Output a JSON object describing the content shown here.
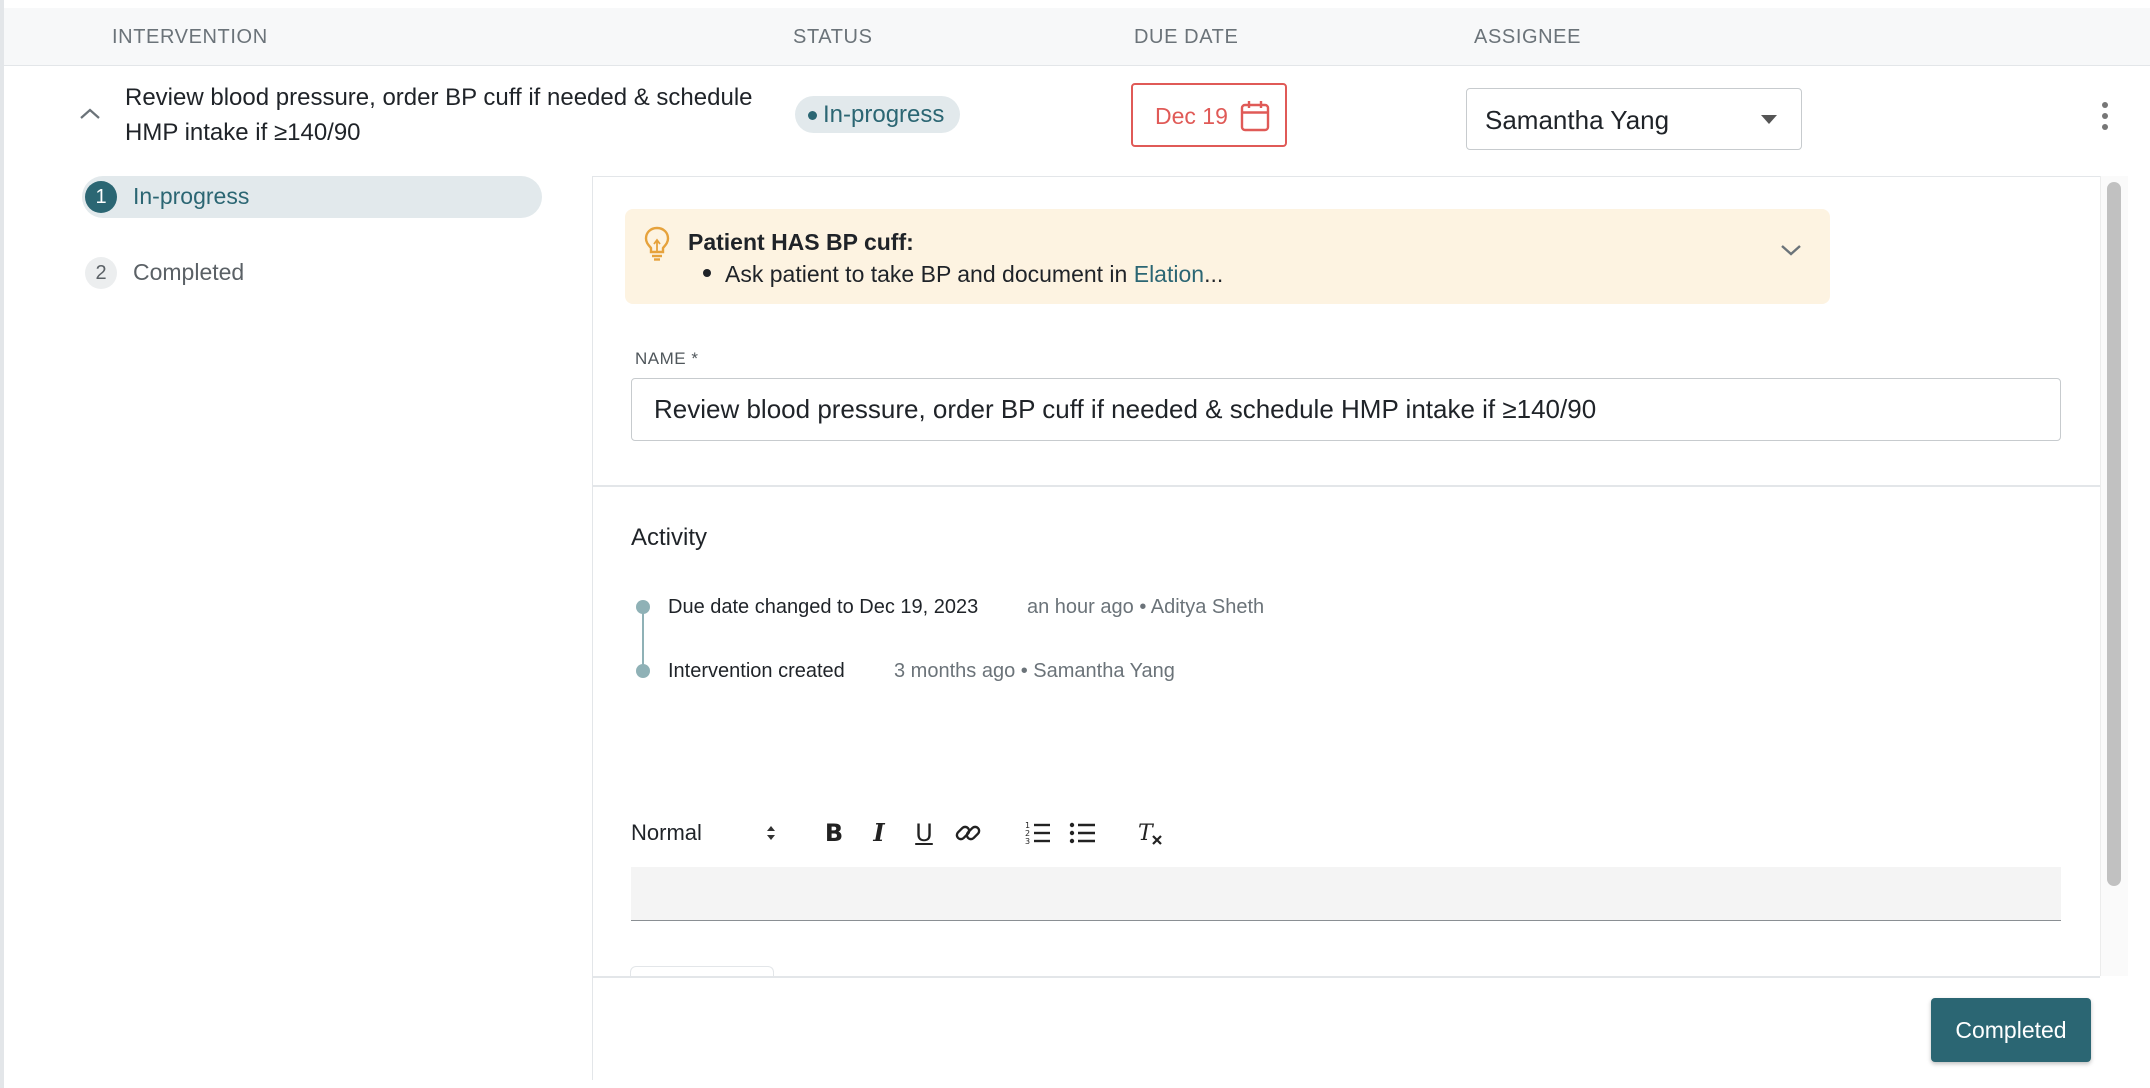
{
  "table": {
    "columns": [
      "INTERVENTION",
      "STATUS",
      "DUE DATE",
      "ASSIGNEE"
    ]
  },
  "row": {
    "title_line1": "Review blood pressure, order BP cuff if needed & schedule",
    "title_line2": "HMP intake if ≥140/90",
    "status": "In-progress",
    "due_date": "Dec 19",
    "assignee": "Samantha Yang"
  },
  "stepper": {
    "steps": [
      {
        "number": "1",
        "label": "In-progress"
      },
      {
        "number": "2",
        "label": "Completed"
      }
    ]
  },
  "tip": {
    "title": "Patient HAS BP cuff:",
    "line_prefix": "Ask patient to take BP and document in ",
    "line_link": "Elation",
    "line_suffix": "..."
  },
  "form": {
    "name_label": "NAME *",
    "name_value": "Review blood pressure, order BP cuff if needed & schedule HMP intake if ≥140/90"
  },
  "activity": {
    "title": "Activity",
    "items": [
      {
        "text": "Due date changed to Dec 19, 2023",
        "meta": "an hour ago • Aditya Sheth"
      },
      {
        "text": "Intervention created",
        "meta": "3 months ago • Samantha Yang"
      }
    ]
  },
  "editor": {
    "format_select": "Normal",
    "buttons": {
      "bold": "B",
      "italic": "I",
      "underline": "U",
      "clear": "T"
    }
  },
  "footer": {
    "complete_button": "Completed"
  },
  "colors": {
    "accent": "#2b6673",
    "due_red": "#e05a57",
    "tip_bg": "#fdf3e1",
    "bulb": "#e6a23c"
  }
}
